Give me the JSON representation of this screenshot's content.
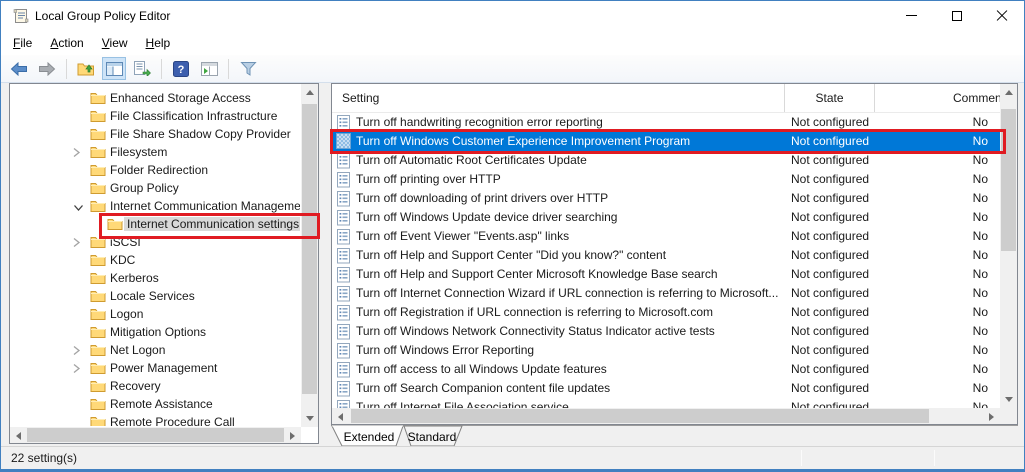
{
  "window": {
    "title": "Local Group Policy Editor",
    "icon": "gpedit-scroll-icon",
    "controls": [
      "minimize",
      "maximize",
      "close"
    ]
  },
  "menu": {
    "items": [
      "File",
      "Action",
      "View",
      "Help"
    ]
  },
  "toolbar": {
    "buttons": [
      "back",
      "forward",
      "up-one-level",
      "show-console-tree",
      "export-list",
      "help",
      "show-action-pane",
      "filter"
    ],
    "checked_button": "show-console-tree"
  },
  "tree": {
    "items": [
      {
        "label": "Enhanced Storage Access",
        "chevron": "none",
        "indent": 0,
        "selected": false
      },
      {
        "label": "File Classification Infrastructure",
        "chevron": "none",
        "indent": 0,
        "selected": false
      },
      {
        "label": "File Share Shadow Copy Provider",
        "chevron": "none",
        "indent": 0,
        "selected": false
      },
      {
        "label": "Filesystem",
        "chevron": "collapsed",
        "indent": 0,
        "selected": false
      },
      {
        "label": "Folder Redirection",
        "chevron": "none",
        "indent": 0,
        "selected": false
      },
      {
        "label": "Group Policy",
        "chevron": "none",
        "indent": 0,
        "selected": false
      },
      {
        "label": "Internet Communication Management",
        "chevron": "expanded",
        "indent": 0,
        "selected": false
      },
      {
        "label": "Internet Communication settings",
        "chevron": "none",
        "indent": 1,
        "selected": true
      },
      {
        "label": "iSCSI",
        "chevron": "collapsed",
        "indent": 0,
        "selected": false
      },
      {
        "label": "KDC",
        "chevron": "none",
        "indent": 0,
        "selected": false
      },
      {
        "label": "Kerberos",
        "chevron": "none",
        "indent": 0,
        "selected": false
      },
      {
        "label": "Locale Services",
        "chevron": "none",
        "indent": 0,
        "selected": false
      },
      {
        "label": "Logon",
        "chevron": "none",
        "indent": 0,
        "selected": false
      },
      {
        "label": "Mitigation Options",
        "chevron": "none",
        "indent": 0,
        "selected": false
      },
      {
        "label": "Net Logon",
        "chevron": "collapsed",
        "indent": 0,
        "selected": false
      },
      {
        "label": "Power Management",
        "chevron": "collapsed",
        "indent": 0,
        "selected": false
      },
      {
        "label": "Recovery",
        "chevron": "none",
        "indent": 0,
        "selected": false
      },
      {
        "label": "Remote Assistance",
        "chevron": "none",
        "indent": 0,
        "selected": false
      },
      {
        "label": "Remote Procedure Call",
        "chevron": "none",
        "indent": 0,
        "selected": false
      }
    ]
  },
  "list": {
    "columns": [
      {
        "label": "Setting"
      },
      {
        "label": "State"
      },
      {
        "label": "Comment"
      }
    ],
    "rows": [
      {
        "setting": "Turn off handwriting recognition error reporting",
        "state": "Not configured",
        "comment": "No",
        "selected": false
      },
      {
        "setting": "Turn off Windows Customer Experience Improvement Program",
        "state": "Not configured",
        "comment": "No",
        "selected": true
      },
      {
        "setting": "Turn off Automatic Root Certificates Update",
        "state": "Not configured",
        "comment": "No",
        "selected": false
      },
      {
        "setting": "Turn off printing over HTTP",
        "state": "Not configured",
        "comment": "No",
        "selected": false
      },
      {
        "setting": "Turn off downloading of print drivers over HTTP",
        "state": "Not configured",
        "comment": "No",
        "selected": false
      },
      {
        "setting": "Turn off Windows Update device driver searching",
        "state": "Not configured",
        "comment": "No",
        "selected": false
      },
      {
        "setting": "Turn off Event Viewer \"Events.asp\" links",
        "state": "Not configured",
        "comment": "No",
        "selected": false
      },
      {
        "setting": "Turn off Help and Support Center \"Did you know?\" content",
        "state": "Not configured",
        "comment": "No",
        "selected": false
      },
      {
        "setting": "Turn off Help and Support Center Microsoft Knowledge Base search",
        "state": "Not configured",
        "comment": "No",
        "selected": false
      },
      {
        "setting": "Turn off Internet Connection Wizard if URL connection is referring to Microsoft...",
        "state": "Not configured",
        "comment": "No",
        "selected": false
      },
      {
        "setting": "Turn off Registration if URL connection is referring to Microsoft.com",
        "state": "Not configured",
        "comment": "No",
        "selected": false
      },
      {
        "setting": "Turn off Windows Network Connectivity Status Indicator active tests",
        "state": "Not configured",
        "comment": "No",
        "selected": false
      },
      {
        "setting": "Turn off Windows Error Reporting",
        "state": "Not configured",
        "comment": "No",
        "selected": false
      },
      {
        "setting": "Turn off access to all Windows Update features",
        "state": "Not configured",
        "comment": "No",
        "selected": false
      },
      {
        "setting": "Turn off Search Companion content file updates",
        "state": "Not configured",
        "comment": "No",
        "selected": false
      },
      {
        "setting": "Turn off Internet File Association service",
        "state": "Not configured",
        "comment": "No",
        "selected": false
      }
    ]
  },
  "tabs": {
    "items": [
      {
        "label": "Extended",
        "active": true
      },
      {
        "label": "Standard",
        "active": false
      }
    ]
  },
  "status_bar": {
    "text": "22 setting(s)"
  },
  "colors": {
    "selection_blue": "#0078d7",
    "annotation_red": "#e01b22",
    "window_border_blue": "#4180c0",
    "tree_inactive_selection": "#d9d9d9",
    "folder_yellow": "#ffd978"
  }
}
